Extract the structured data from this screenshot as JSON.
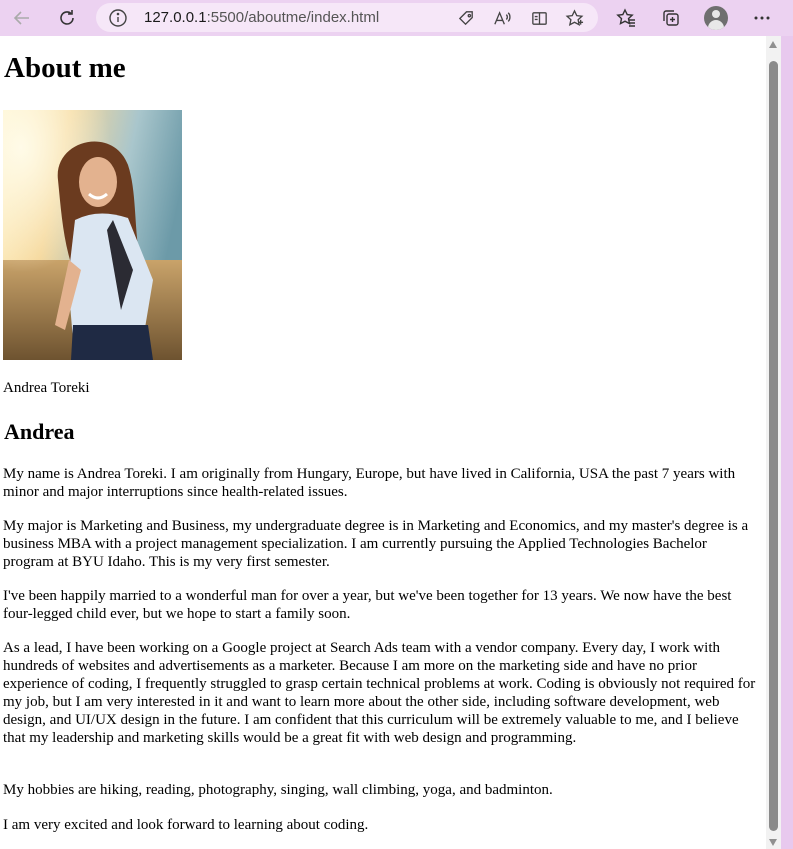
{
  "browser": {
    "url_host": "127.0.0.1",
    "url_rest": ":5500/aboutme/index.html",
    "icons": {
      "back": "back-arrow-icon",
      "refresh": "refresh-icon",
      "info": "info-icon",
      "tag": "tag-icon",
      "read_aloud": "read-aloud-icon",
      "reader": "reader-view-icon",
      "favorite_add": "favorite-add-icon",
      "favorites": "favorites-icon",
      "collections": "collections-icon",
      "profile": "profile-icon",
      "more": "more-icon"
    }
  },
  "page": {
    "heading": "About me",
    "photo_caption": "Andrea Toreki",
    "subheading": "Andrea",
    "paragraphs": [
      "My name is Andrea Toreki. I am originally from Hungary, Europe, but have lived in California, USA the past 7 years with minor and major interruptions since health-related issues.",
      "My major is Marketing and Business, my undergraduate degree is in Marketing and Economics, and my master's degree is a business MBA with a project management specialization. I am currently pursuing the Applied Technologies Bachelor program at BYU Idaho. This is my very first semester.",
      "I've been happily married to a wonderful man for over a year, but we've been together for 13 years. We now have the best four-legged child ever, but we hope to start a family soon.",
      "As a lead, I have been working on a Google project at Search Ads team with a vendor company. Every day, I work with hundreds of websites and advertisements as a marketer. Because I am more on the marketing side and have no prior experience of coding, I frequently struggled to grasp certain technical problems at work. Coding is obviously not required for my job, but I am very interested in it and want to learn more about the other side, including software development, web design, and UI/UX design in the future. I am confident that this curriculum will be extremely valuable to me, and I believe that my leadership and marketing skills would be a great fit with web design and programming.",
      "My hobbies are hiking, reading, photography, singing, wall climbing, yoga, and badminton.",
      "I am very excited and look forward to learning about coding."
    ]
  }
}
